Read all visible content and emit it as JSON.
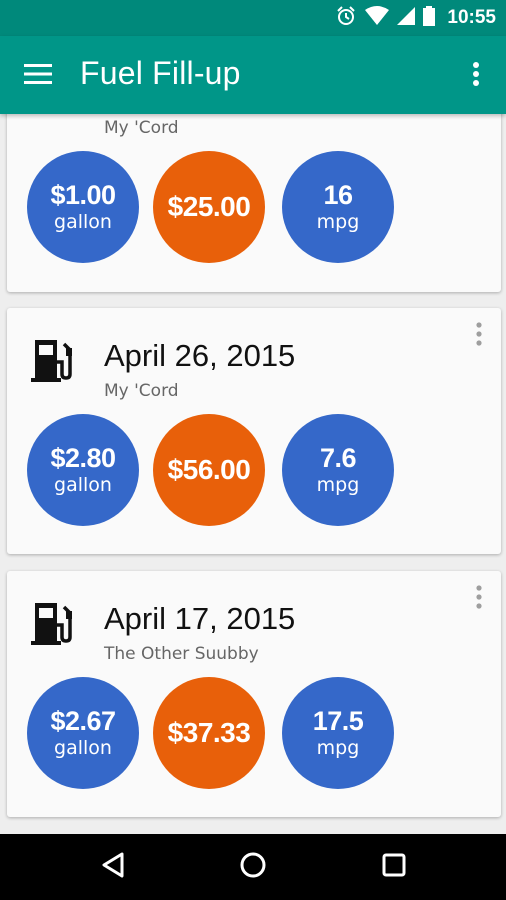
{
  "status_bar": {
    "time": "10:55"
  },
  "app_bar": {
    "title": "Fuel Fill-up"
  },
  "colors": {
    "primary": "#009688",
    "primary_dark": "#00897b",
    "price_circle": "#3568c9",
    "total_circle": "#e8600a"
  },
  "entries": [
    {
      "date": "",
      "vehicle": "My 'Cord",
      "price": "$1.00",
      "price_unit": "gallon",
      "total": "$25.00",
      "economy": "16",
      "economy_unit": "mpg"
    },
    {
      "date": "April 26, 2015",
      "vehicle": "My 'Cord",
      "price": "$2.80",
      "price_unit": "gallon",
      "total": "$56.00",
      "economy": "7.6",
      "economy_unit": "mpg"
    },
    {
      "date": "April 17, 2015",
      "vehicle": "The Other Suubby",
      "price": "$2.67",
      "price_unit": "gallon",
      "total": "$37.33",
      "economy": "17.5",
      "economy_unit": "mpg"
    }
  ]
}
